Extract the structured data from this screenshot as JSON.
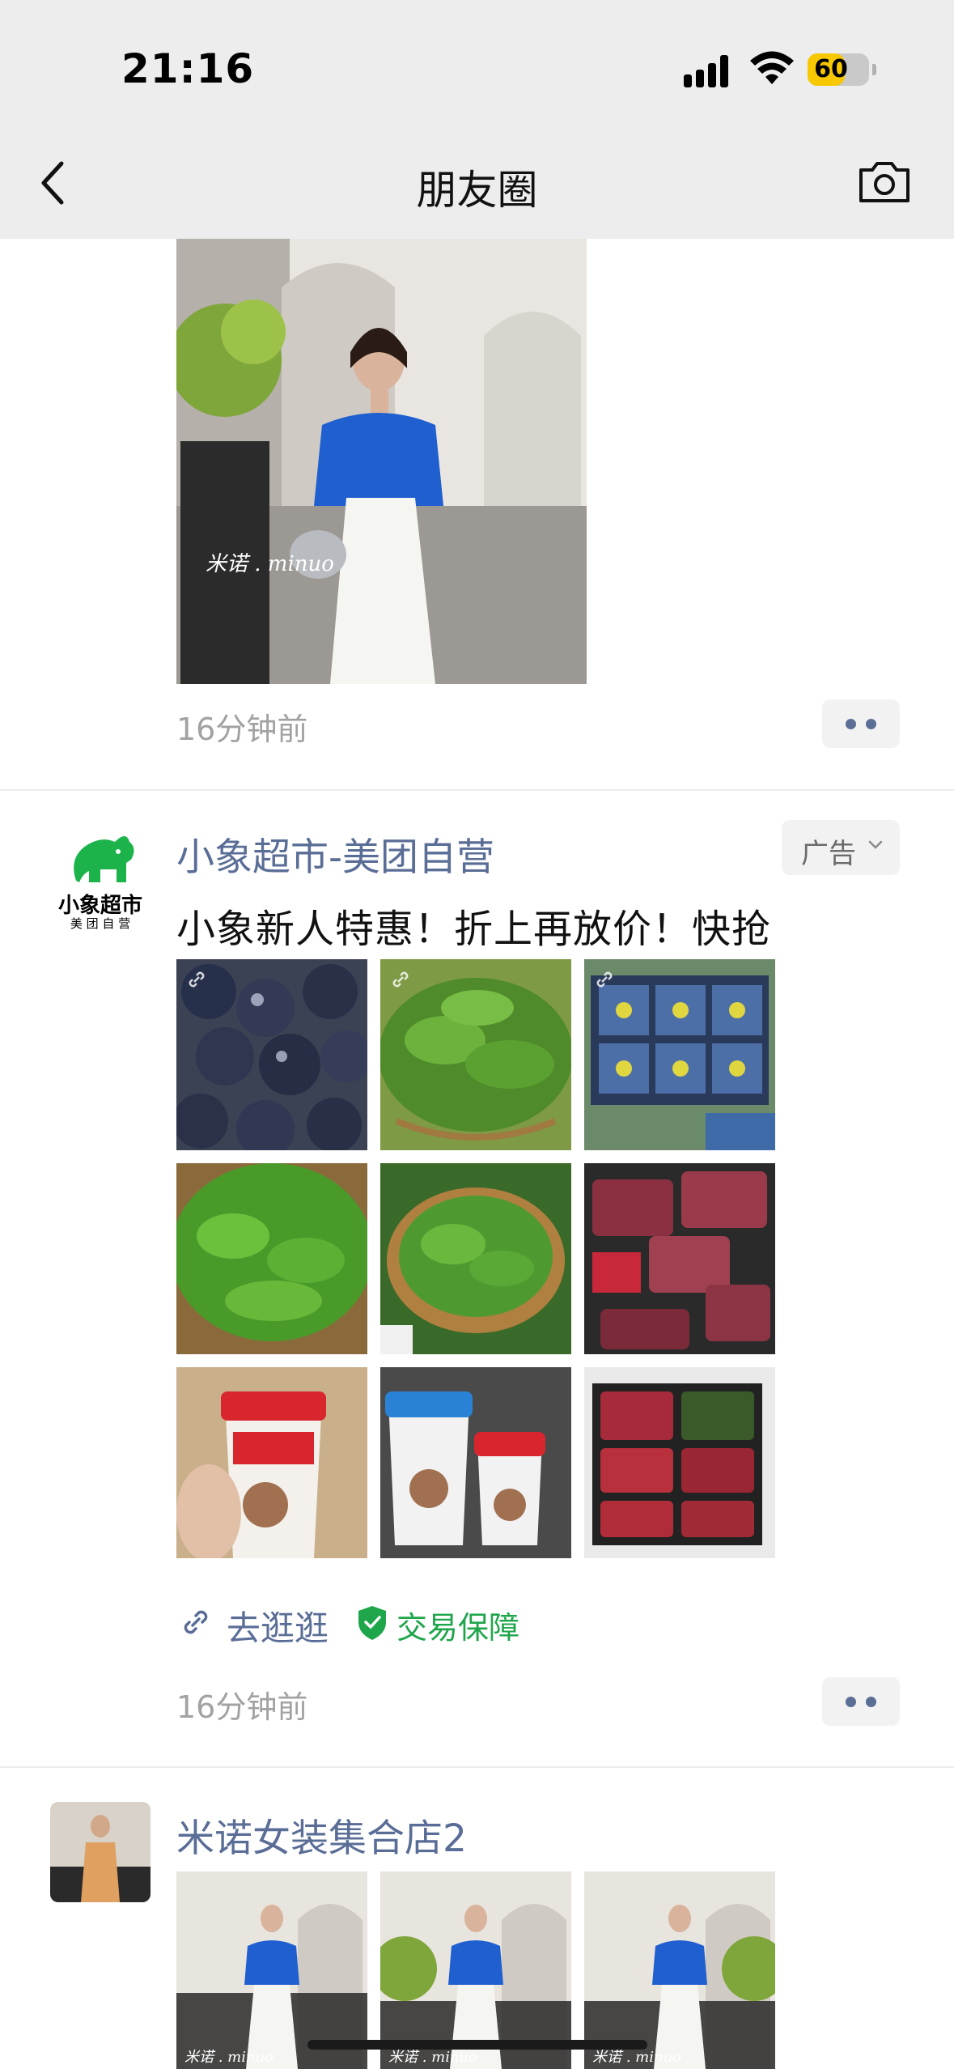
{
  "status_bar": {
    "time": "21:16",
    "battery": "60",
    "battery_level": 0.6
  },
  "nav": {
    "title": "朋友圈"
  },
  "posts": [
    {
      "time": "16分钟前",
      "watermark": "米诺.minuo"
    },
    {
      "author": "小象超市-美团自营",
      "ad_label": "广告",
      "text": "小象新人特惠！折上再放价！快抢",
      "link_label": "去逛逛",
      "guarantee_label": "交易保障",
      "time": "16分钟前",
      "logo_line1": "小象超市",
      "logo_line2": "美 团 自 营",
      "images": [
        "blueberries",
        "pea-shoots",
        "blueberry-boxes",
        "pea-shoots-basket",
        "greens-basket",
        "beef-trays",
        "yogurt-cup-red",
        "yogurt-cups",
        "meat-platter"
      ]
    },
    {
      "author": "米诺女装集合店2",
      "watermark": "米诺.minuo"
    }
  ],
  "colors": {
    "link": "#5a6d96",
    "guarantee": "#1fa64a",
    "logo_green": "#1db34b",
    "nav_bg": "#ededed"
  },
  "icons": {
    "back": "chevron-left-icon",
    "camera": "camera-icon",
    "more": "more-dots-icon",
    "link": "link-icon",
    "shield": "shield-check-icon"
  }
}
